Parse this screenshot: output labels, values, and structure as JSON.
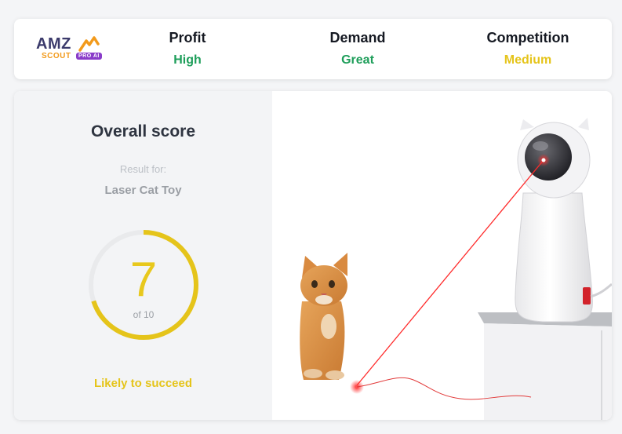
{
  "brand": {
    "name_top": "AMZ",
    "name_bottom": "SCOUT",
    "badge": "PRO AI"
  },
  "metrics": [
    {
      "label": "Profit",
      "value": "High",
      "color": "#1e9e5a"
    },
    {
      "label": "Demand",
      "value": "Great",
      "color": "#1e9e5a"
    },
    {
      "label": "Competition",
      "value": "Medium",
      "color": "#e5c41a"
    }
  ],
  "score_card": {
    "title": "Overall score",
    "result_for_label": "Result for:",
    "product_name": "Laser Cat Toy",
    "score": "7",
    "score_max_text": "of 10",
    "score_fraction": 0.7,
    "verdict": "Likely to succeed",
    "accent_color": "#e5c41a"
  },
  "image": {
    "subject": "cat-laser-toy-photo"
  }
}
